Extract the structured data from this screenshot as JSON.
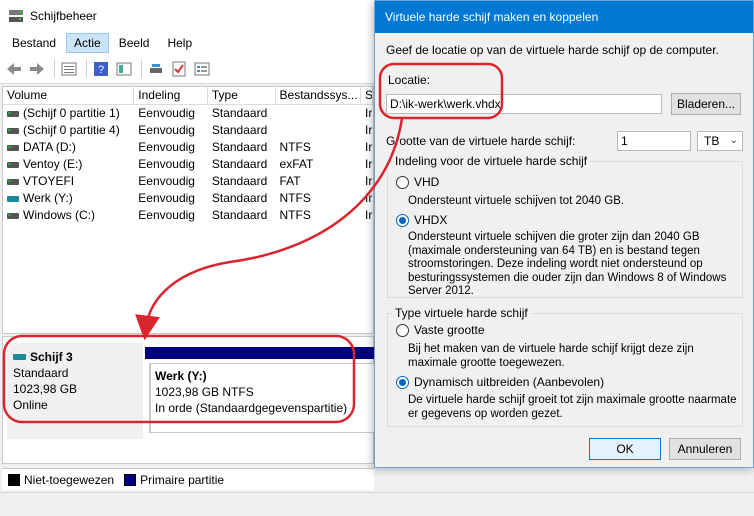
{
  "main": {
    "title": "Schijfbeheer",
    "menu": [
      "Bestand",
      "Actie",
      "Beeld",
      "Help"
    ],
    "columns": [
      "Volume",
      "Indeling",
      "Type",
      "Bestandssys...",
      "S"
    ],
    "volumes": [
      {
        "name": "(Schijf 0 partitie 1)",
        "layout": "Eenvoudig",
        "type": "Standaard",
        "fs": "",
        "s": "Ir"
      },
      {
        "name": "(Schijf 0 partitie 4)",
        "layout": "Eenvoudig",
        "type": "Standaard",
        "fs": "",
        "s": "Ir"
      },
      {
        "name": "DATA (D:)",
        "layout": "Eenvoudig",
        "type": "Standaard",
        "fs": "NTFS",
        "s": "Ir"
      },
      {
        "name": "Ventoy (E:)",
        "layout": "Eenvoudig",
        "type": "Standaard",
        "fs": "exFAT",
        "s": "Ir"
      },
      {
        "name": "VTOYEFI",
        "layout": "Eenvoudig",
        "type": "Standaard",
        "fs": "FAT",
        "s": "Ir"
      },
      {
        "name": "Werk (Y:)",
        "layout": "Eenvoudig",
        "type": "Standaard",
        "fs": "NTFS",
        "s": "Ir"
      },
      {
        "name": "Windows  (C:)",
        "layout": "Eenvoudig",
        "type": "Standaard",
        "fs": "NTFS",
        "s": "Ir"
      }
    ],
    "disk": {
      "name": "Schijf 3",
      "type": "Standaard",
      "size": "1023,98 GB",
      "status": "Online"
    },
    "partition": {
      "name": "Werk  (Y:)",
      "size": "1023,98 GB NTFS",
      "status": "In orde (Standaardgegevenspartitie)"
    },
    "legend": {
      "unallocated": "Niet-toegewezen",
      "primary": "Primaire partitie"
    }
  },
  "dialog": {
    "title": "Virtuele harde schijf maken en koppelen",
    "intro": "Geef de locatie op van de virtuele harde schijf op de computer.",
    "location_label": "Locatie:",
    "location_value": "D:\\ik-werk\\werk.vhdx",
    "browse": "Bladeren...",
    "size_label": "Grootte van de virtuele harde schijf:",
    "size_value": "1",
    "size_unit": "TB",
    "format_group": "Indeling voor de virtuele harde schijf",
    "vhd_label": "VHD",
    "vhd_desc": "Ondersteunt virtuele schijven tot 2040 GB.",
    "vhdx_label": "VHDX",
    "vhdx_desc": "Ondersteunt virtuele schijven die groter zijn dan 2040 GB (maximale ondersteuning van 64 TB) en is bestand tegen stroomstoringen. Deze indeling wordt niet ondersteund op besturingssystemen die ouder zijn dan Windows 8 of Windows Server 2012.",
    "type_group": "Type virtuele harde schijf",
    "fixed_label": "Vaste grootte",
    "fixed_desc": "Bij het maken van de virtuele harde schijf krijgt deze zijn maximale grootte toegewezen.",
    "dynamic_label": "Dynamisch uitbreiden (Aanbevolen)",
    "dynamic_desc": "De virtuele harde schijf groeit tot zijn maximale grootte naarmate er gegevens op worden gezet.",
    "ok": "OK",
    "cancel": "Annuleren"
  },
  "colors": {
    "annotation": "#d9262e",
    "primary_partition": "#00007f",
    "accent": "#0078d4"
  }
}
